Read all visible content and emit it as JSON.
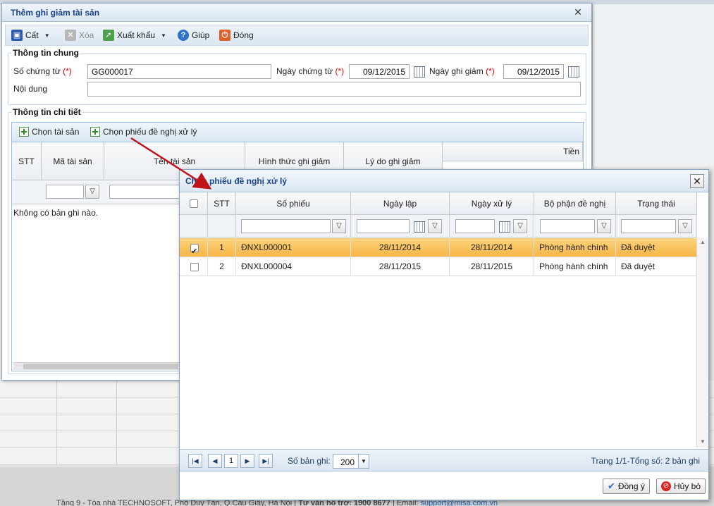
{
  "background": {
    "footer_text_prefix": "Tầng 9 - Tòa nhà TECHNOSOFT, Phố Duy Tân, Q.Cầu Giấy, Hà Nội |",
    "footer_hotline": "Tư vấn hỗ trợ: 1900 8677",
    "footer_email_label": "| Email:",
    "footer_email": "support@misa.com.vn"
  },
  "main_dialog": {
    "title": "Thêm ghi giảm tài sản",
    "toolbar": {
      "cut": "Cất",
      "delete": "Xóa",
      "export": "Xuất khẩu",
      "help": "Giúp",
      "close": "Đóng"
    },
    "general": {
      "legend": "Thông tin chung",
      "voucher_no_label": "Số chứng từ",
      "required_mark": "(*)",
      "voucher_no": "GG000017",
      "voucher_date_label": "Ngày chứng từ",
      "voucher_date": "09/12/2015",
      "reduce_date_label": "Ngày ghi giảm",
      "reduce_date": "09/12/2015",
      "content_label": "Nội dung",
      "content": ""
    },
    "detail": {
      "legend": "Thông tin chi tiết",
      "choose_asset": "Chọn tài sản",
      "choose_proposal": "Chọn phiếu đề nghị xử lý",
      "columns": {
        "stt": "STT",
        "asset_code": "Mã tài sản",
        "asset_name": "Tên tài sản",
        "method": "Hình thức ghi giảm",
        "reason": "Lý do ghi giảm",
        "money": "Tiền"
      },
      "empty": "Không có bản ghi nào."
    }
  },
  "proposal_dialog": {
    "title": "Chọn phiếu đề nghị xử lý",
    "columns": {
      "stt": "STT",
      "voucher_no": "Số phiếu",
      "created_date": "Ngày lập",
      "process_date": "Ngày xử lý",
      "department": "Bộ phận đề nghị",
      "status": "Trạng thái"
    },
    "rows": [
      {
        "checked": true,
        "stt": "1",
        "voucher_no": "ĐNXL000001",
        "created_date": "28/11/2014",
        "process_date": "28/11/2014",
        "department": "Phòng hành chính",
        "status": "Đã duyệt"
      },
      {
        "checked": false,
        "stt": "2",
        "voucher_no": "ĐNXL000004",
        "created_date": "28/11/2015",
        "process_date": "28/11/2015",
        "department": "Phòng hành chính",
        "status": "Đã duyệt"
      }
    ],
    "pager": {
      "page": "1",
      "page_size_label": "Số bản ghi:",
      "page_size": "200",
      "summary": "Trang 1/1-Tổng số: 2 bản ghi"
    },
    "ok": "Đồng ý",
    "cancel": "Hủy bỏ"
  },
  "colors": {
    "title_text": "#15428b",
    "selected_row": "#f7b646",
    "required": "#dd0000",
    "arrow": "#c0141a"
  }
}
